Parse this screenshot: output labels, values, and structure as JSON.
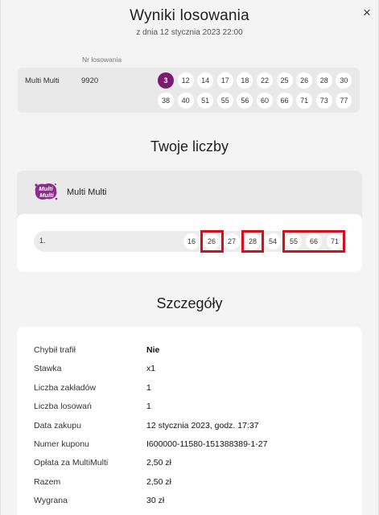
{
  "header": {
    "title": "Wyniki losowania",
    "subtitle": "z dnia 12 stycznia 2023 22:00",
    "close_icon": "×"
  },
  "draw": {
    "nr_label": "Nr losowania",
    "game": "Multi Multi",
    "number": "9920",
    "bonus_ball": "3",
    "balls": [
      "12",
      "14",
      "17",
      "18",
      "22",
      "25",
      "26",
      "28",
      "30",
      "38",
      "40",
      "51",
      "55",
      "56",
      "60",
      "66",
      "71",
      "73",
      "77"
    ]
  },
  "your_numbers": {
    "title": "Twoje liczby",
    "game_name": "Multi Multi",
    "logo_text_top": "Multi",
    "logo_text_bottom": "Multi",
    "line_label": "1.",
    "picks": [
      "16",
      "26",
      "27",
      "28",
      "54",
      "55",
      "66",
      "71"
    ]
  },
  "details": {
    "title": "Szczegóły",
    "rows": [
      {
        "label": "Chybił trafił",
        "value": "Nie"
      },
      {
        "label": "Stawka",
        "value": "x1"
      },
      {
        "label": "Liczba zakładów",
        "value": "1"
      },
      {
        "label": "Liczba losowań",
        "value": "1"
      },
      {
        "label": "Data zakupu",
        "value": "12 stycznia 2023, godz. 17:37"
      },
      {
        "label": "Numer kuponu",
        "value": "I600000-11580-151388389-1-27"
      },
      {
        "label": "Opłata za MultiMulti",
        "value": "2,50 zł"
      },
      {
        "label": "Razem",
        "value": "2,50 zł"
      },
      {
        "label": "Wygrana",
        "value": "30 zł"
      }
    ]
  },
  "colors": {
    "bonus_ball": "#7b1c6e",
    "highlight_frame": "#d0101e",
    "logo": "#8e2a8b"
  }
}
